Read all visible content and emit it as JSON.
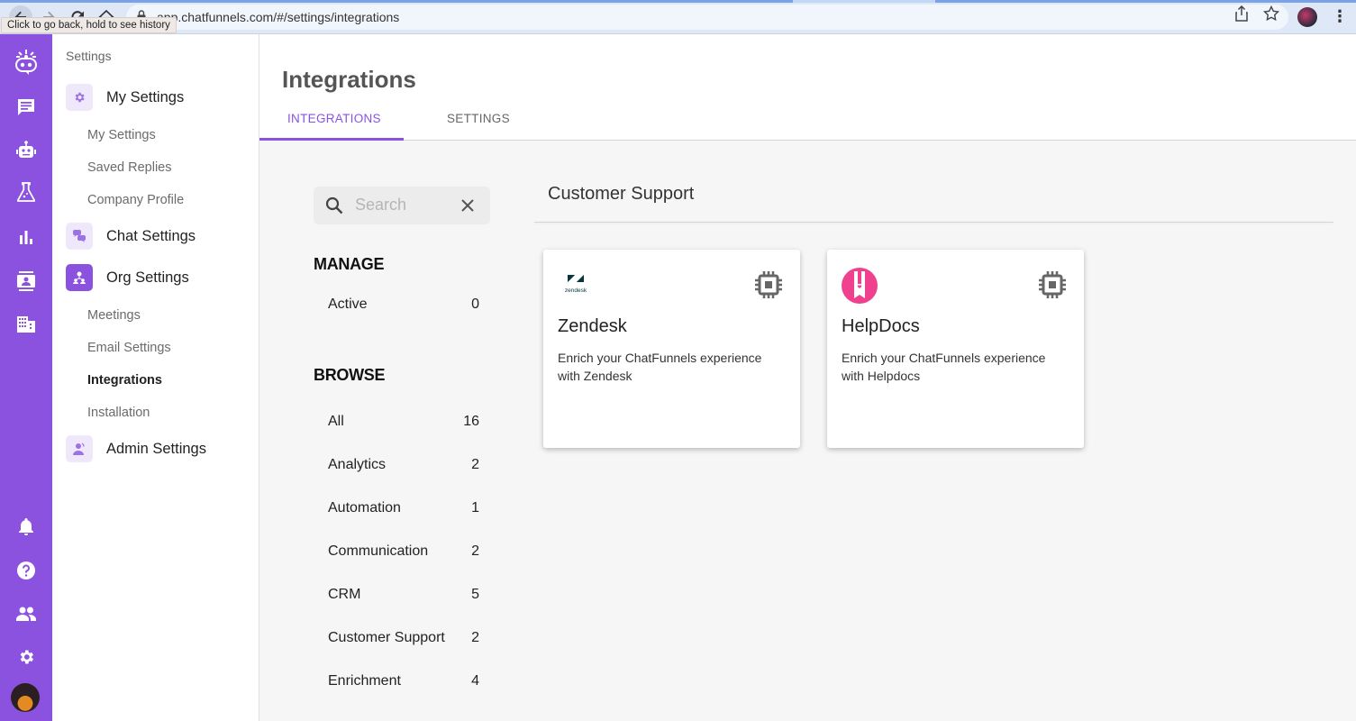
{
  "browser": {
    "url": "app.chatfunnels.com/#/settings/integrations",
    "tooltip": "Click to go back, hold to see history",
    "page_load_progress": 0.58
  },
  "rail": {
    "items": [
      {
        "icon": "bot-logo-icon"
      },
      {
        "icon": "chat-icon"
      },
      {
        "icon": "robot-icon"
      },
      {
        "icon": "flask-icon"
      },
      {
        "icon": "bar-chart-icon"
      },
      {
        "icon": "contact-icon"
      },
      {
        "icon": "building-icon"
      }
    ],
    "bottom_items": [
      {
        "icon": "bell-icon"
      },
      {
        "icon": "help-icon"
      },
      {
        "icon": "people-icon"
      },
      {
        "icon": "gear-icon"
      }
    ]
  },
  "sidebar": {
    "title": "Settings",
    "groups": [
      {
        "label": "My Settings",
        "icon": "gear-icon",
        "items": [
          "My Settings",
          "Saved Replies",
          "Company Profile"
        ]
      },
      {
        "label": "Chat Settings",
        "icon": "chat-bubbles-icon",
        "items": []
      },
      {
        "label": "Org Settings",
        "icon": "org-icon",
        "items": [
          "Meetings",
          "Email Settings",
          "Integrations",
          "Installation"
        ]
      },
      {
        "label": "Admin Settings",
        "icon": "admin-icon",
        "items": []
      }
    ],
    "active_item": "Integrations"
  },
  "main": {
    "title": "Integrations",
    "tabs": [
      {
        "label": "INTEGRATIONS",
        "active": true
      },
      {
        "label": "SETTINGS",
        "active": false
      }
    ],
    "search": {
      "placeholder": "Search",
      "value": ""
    },
    "manage": {
      "heading": "MANAGE",
      "items": [
        {
          "label": "Active",
          "count": "0"
        }
      ]
    },
    "browse": {
      "heading": "BROWSE",
      "items": [
        {
          "label": "All",
          "count": "16"
        },
        {
          "label": "Analytics",
          "count": "2"
        },
        {
          "label": "Automation",
          "count": "1"
        },
        {
          "label": "Communication",
          "count": "2"
        },
        {
          "label": "CRM",
          "count": "5"
        },
        {
          "label": "Customer Support",
          "count": "2"
        },
        {
          "label": "Enrichment",
          "count": "4"
        }
      ]
    },
    "category": "Customer Support",
    "cards": [
      {
        "name": "Zendesk",
        "logo_text": "zendesk",
        "description": "Enrich your ChatFunnels experience with Zendesk"
      },
      {
        "name": "HelpDocs",
        "description": "Enrich your ChatFunnels experience with Helpdocs"
      }
    ]
  },
  "colors": {
    "accent": "#8a52df",
    "helpdocs_pink": "#f0418f",
    "zendesk_dark": "#03363d"
  }
}
